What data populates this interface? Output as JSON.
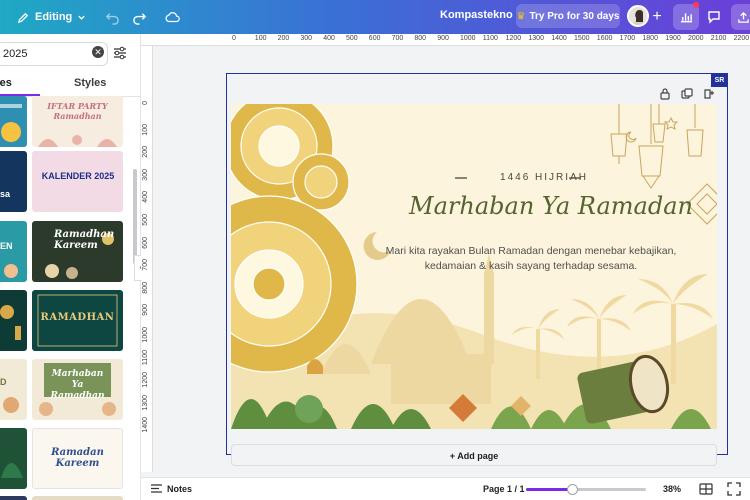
{
  "topbar": {
    "edit_mode": "Editing",
    "doc_title": "Kompastekno",
    "try_pro": "Try Pro for 30 days"
  },
  "panel": {
    "search_value": "2025",
    "tabs": [
      {
        "label": "tes",
        "active": true
      },
      {
        "label": "Styles",
        "active": false
      }
    ],
    "thumbs": [
      {
        "label": "IFTAR PARTY Ramadhan"
      },
      {
        "label": "KALENDER 2025"
      },
      {
        "label": "Ramadhan Kareem"
      },
      {
        "label": "RAMADHAN"
      },
      {
        "label": "Marhaban Ya Ramadhan"
      },
      {
        "label": "Ramadan Kareem"
      }
    ],
    "left_thumb_fragments": [
      "sa",
      "EN",
      "D"
    ]
  },
  "ruler": {
    "top": [
      "0",
      "100",
      "200",
      "300",
      "400",
      "500",
      "600",
      "700",
      "800",
      "900",
      "1000",
      "1100",
      "1200",
      "1300",
      "1400",
      "1500",
      "1600",
      "1700",
      "1800",
      "1900",
      "2000",
      "2100",
      "2200"
    ],
    "left": [
      "0",
      "100",
      "200",
      "300",
      "400",
      "500",
      "600",
      "700",
      "800",
      "900",
      "1000",
      "1100",
      "1200",
      "1300",
      "1400"
    ]
  },
  "canvas": {
    "page_tag": "SR",
    "add_page": "+ Add page"
  },
  "design": {
    "hijri": "1446 HIJRIAH",
    "title": "Marhaban Ya Ramadan",
    "body": "Mari kita rayakan Bulan Ramadan dengan menebar kebajikan, kedamaian & kasih sayang terhadap sesama."
  },
  "bottombar": {
    "notes": "Notes",
    "page_indicator": "Page 1 / 1",
    "zoom": "38%",
    "zoom_fraction": 0.38
  },
  "colors": {
    "accent": "#7d2ae8",
    "selection": "#23329a",
    "design_bg": "#fdf4dd",
    "title_green": "#54632f"
  }
}
